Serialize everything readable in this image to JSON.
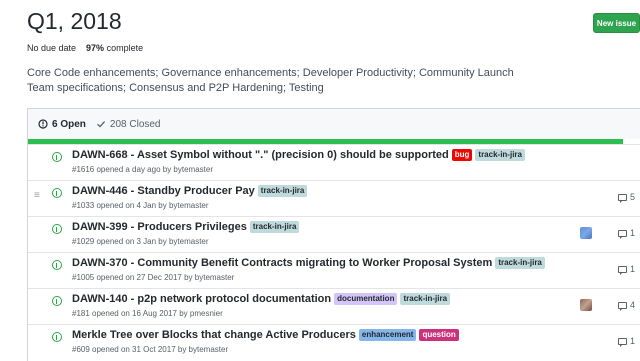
{
  "milestone": {
    "title": "Q1, 2018",
    "due": "No due date",
    "percent": "97%",
    "complete_label": "complete",
    "progress_fraction": 0.97,
    "description": "Core Code enhancements; Governance enhancements; Developer Productivity; Community Launch Team specifications; Consensus and P2P Hardening; Testing"
  },
  "header": {
    "new_issue_label": "New issue"
  },
  "tabs": {
    "open": "6 Open",
    "closed": "208 Closed"
  },
  "issues": [
    {
      "title": "DAWN-668 - Asset Symbol without \".\" (precision 0) should be supported",
      "sub": "#1616 opened a day ago by bytemaster",
      "labels": [
        {
          "text": "bug",
          "kind": "bug"
        },
        {
          "text": "track-in-jira",
          "kind": "jira"
        }
      ],
      "comments": "",
      "avatar": ""
    },
    {
      "title": "DAWN-446 - Standby Producer Pay",
      "sub": "#1033 opened on 4 Jan by bytemaster",
      "labels": [
        {
          "text": "track-in-jira",
          "kind": "jira"
        }
      ],
      "comments": "5",
      "avatar": ""
    },
    {
      "title": "DAWN-399 - Producers Privileges",
      "sub": "#1029 opened on 3 Jan by bytemaster",
      "labels": [
        {
          "text": "track-in-jira",
          "kind": "jira"
        }
      ],
      "comments": "1",
      "avatar": "a"
    },
    {
      "title": "DAWN-370 - Community Benefit Contracts migrating to Worker Proposal System",
      "sub": "#1005 opened on 27 Dec 2017 by bytemaster",
      "labels": [
        {
          "text": "track-in-jira",
          "kind": "jira"
        }
      ],
      "comments": "1",
      "avatar": ""
    },
    {
      "title": "DAWN-140 - p2p network protocol documentation",
      "sub": "#181 opened on 16 Aug 2017 by pmesnier",
      "labels": [
        {
          "text": "documentation",
          "kind": "doc"
        },
        {
          "text": "track-in-jira",
          "kind": "jira"
        }
      ],
      "comments": "4",
      "avatar": "b"
    },
    {
      "title": "Merkle Tree over Blocks that change Active Producers",
      "sub": "#609 opened on 31 Oct 2017 by bytemaster",
      "labels": [
        {
          "text": "enhancement",
          "kind": "enh"
        },
        {
          "text": "question",
          "kind": "q"
        }
      ],
      "comments": "1",
      "avatar": ""
    }
  ],
  "colors": {
    "accent": "#2cbe4e",
    "open_icon": "#28a745",
    "bug": "#ee0701",
    "jira": "#bfdadc",
    "documentation": "#d4c5f9",
    "enhancement": "#84b6eb",
    "question": "#cc317c"
  },
  "icons": {
    "open": "issue-opened-icon",
    "closed": "check-icon",
    "comments": "comment-icon",
    "drag": "drag-handle-icon"
  }
}
